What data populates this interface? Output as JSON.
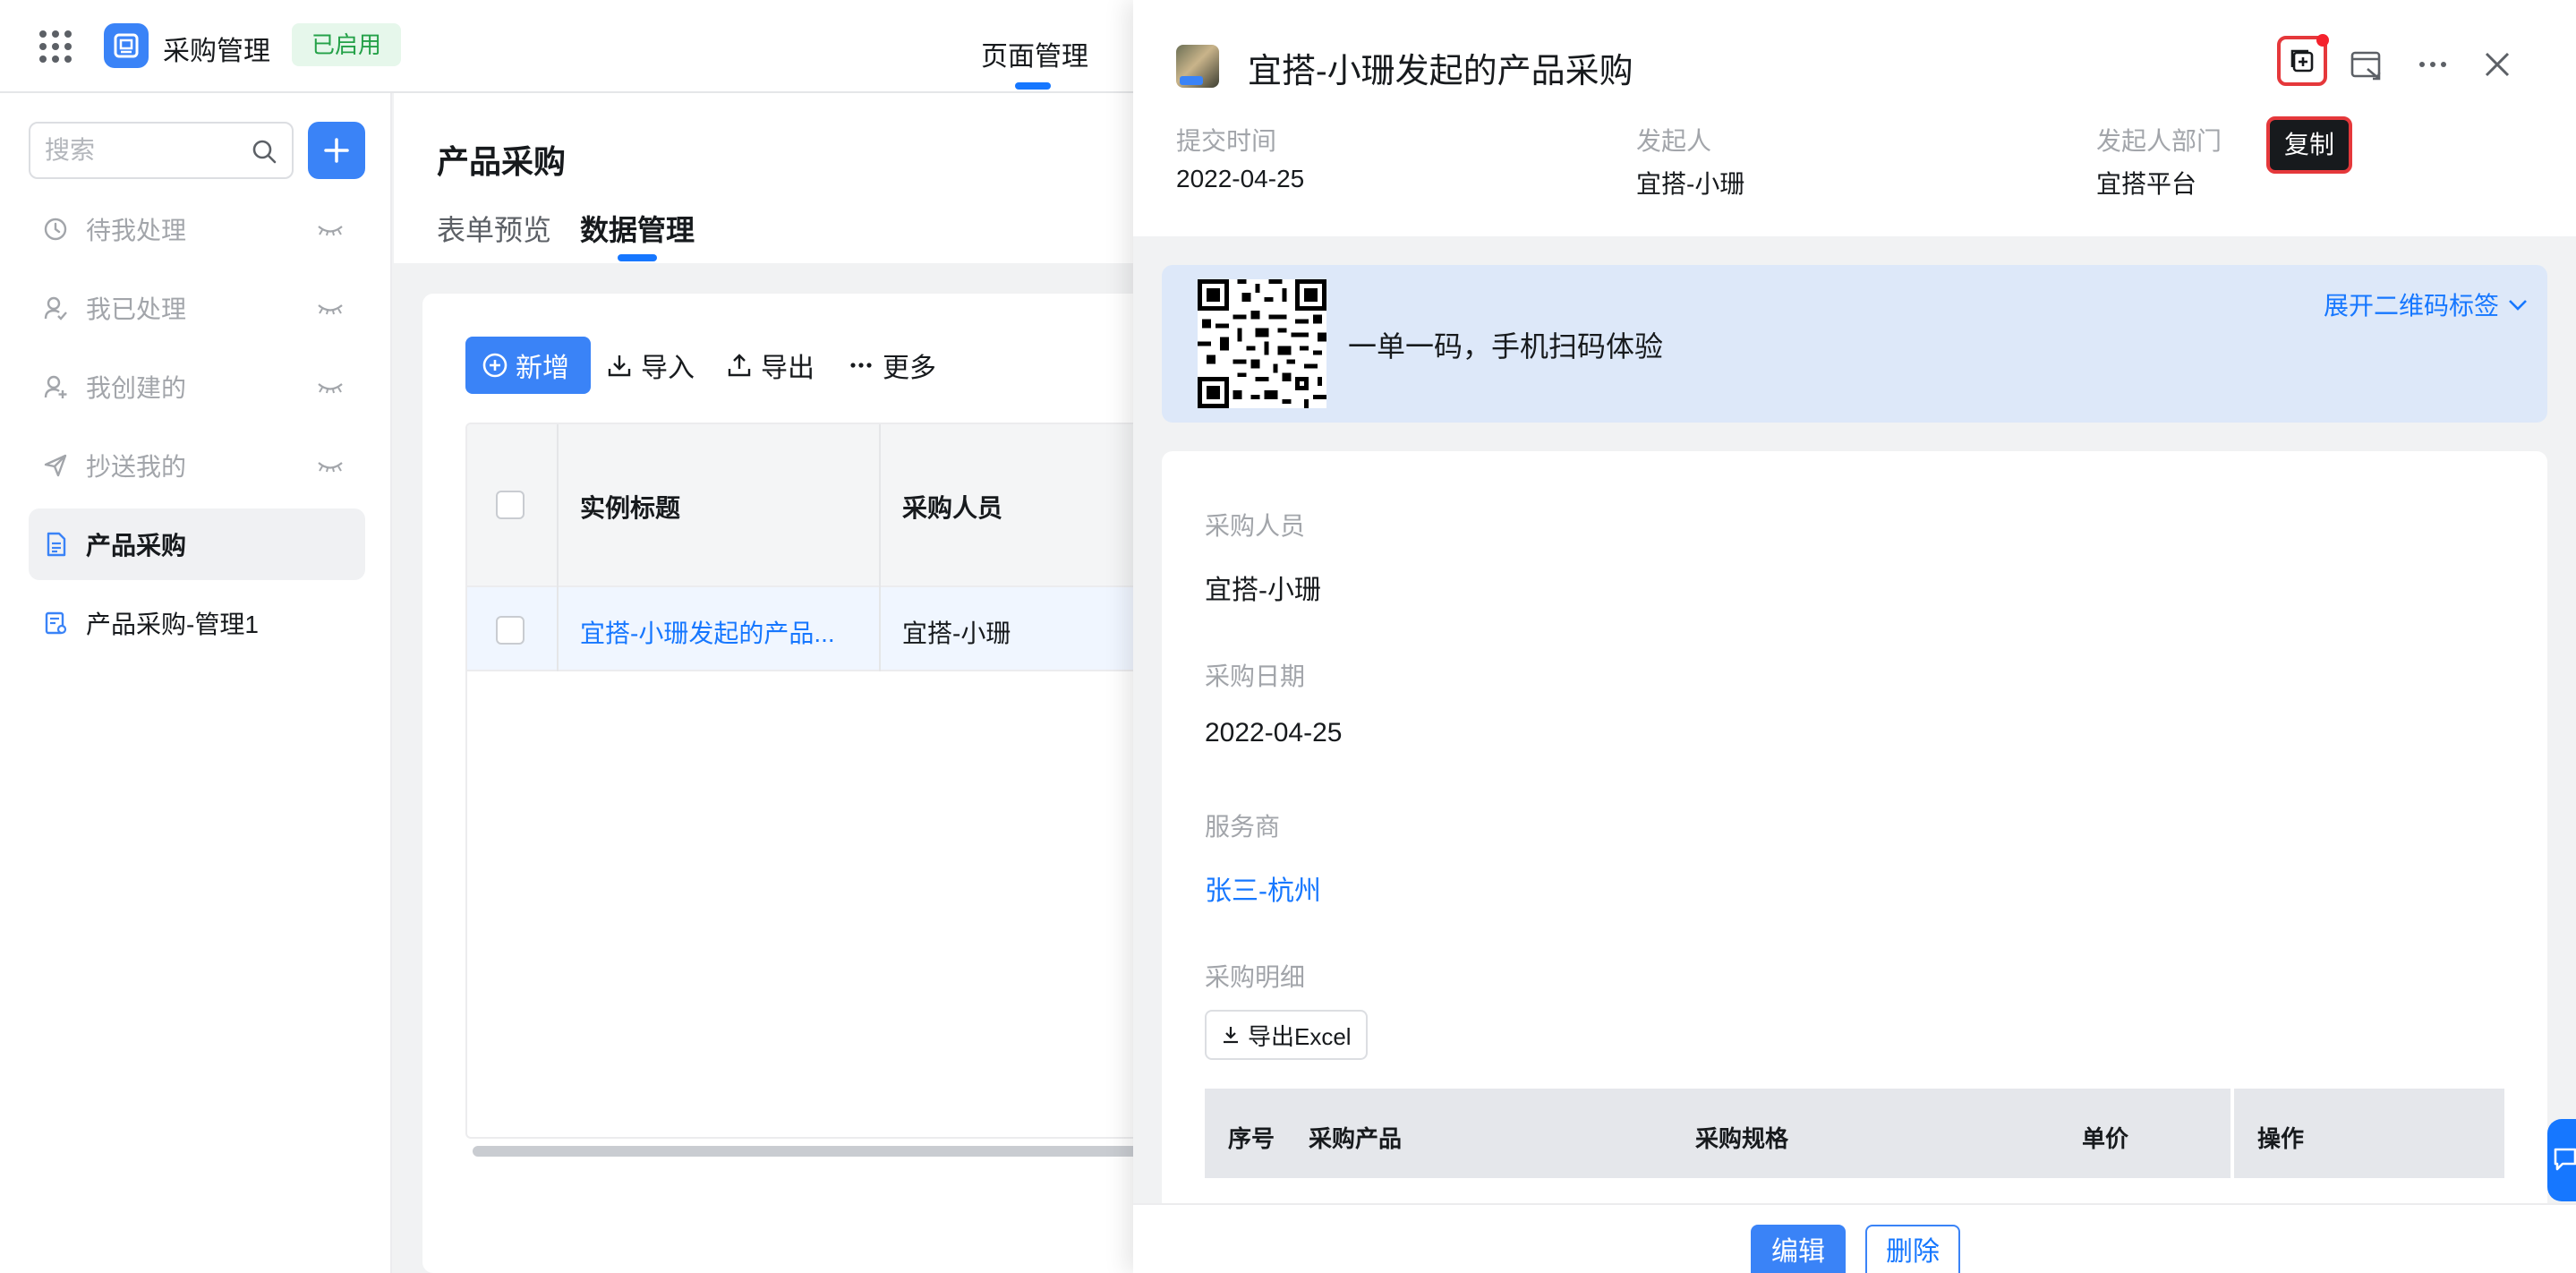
{
  "header": {
    "app_name": "采购管理",
    "app_status": "已启用",
    "top_tab": "页面管理"
  },
  "sidebar": {
    "search_placeholder": "搜索",
    "items": [
      {
        "label": "待我处理",
        "icon": "clock-icon"
      },
      {
        "label": "我已处理",
        "icon": "user-check-icon"
      },
      {
        "label": "我创建的",
        "icon": "user-add-icon"
      },
      {
        "label": "抄送我的",
        "icon": "send-icon"
      },
      {
        "label": "产品采购",
        "icon": "form-icon"
      },
      {
        "label": "产品采购-管理1",
        "icon": "report-icon"
      }
    ]
  },
  "main": {
    "page_title": "产品采购",
    "tabs": [
      "表单预览",
      "数据管理"
    ],
    "active_tab": "数据管理",
    "toolbar": {
      "add": "新增",
      "import": "导入",
      "export": "导出",
      "more": "更多"
    },
    "table": {
      "columns": [
        "实例标题",
        "采购人员"
      ],
      "rows": [
        [
          "宜搭-小珊发起的产品...",
          "宜搭-小珊"
        ]
      ]
    }
  },
  "drawer": {
    "title": "宜搭-小珊发起的产品采购",
    "tooltip": "复制",
    "meta": {
      "submit_time_label": "提交时间",
      "submit_time": "2022-04-25",
      "initiator_label": "发起人",
      "initiator": "宜搭-小珊",
      "department_label": "发起人部门",
      "department": "宜搭平台"
    },
    "qr": {
      "text": "一单一码，手机扫码体验",
      "expand": "展开二维码标签"
    },
    "fields": [
      {
        "label": "采购人员",
        "value": "宜搭-小珊"
      },
      {
        "label": "采购日期",
        "value": "2022-04-25"
      },
      {
        "label": "服务商",
        "value": "张三-杭州"
      },
      {
        "label": "采购明细",
        "value": ""
      }
    ],
    "export_excel": "导出Excel",
    "detail_columns": [
      "序号",
      "采购产品",
      "采购规格",
      "单价",
      "操作"
    ],
    "footer": {
      "edit": "编辑",
      "delete": "删除"
    }
  },
  "colors": {
    "primary": "#3a83f7",
    "link": "#1677ff",
    "status_green": "#24a148",
    "highlight_red": "#e5383b"
  }
}
